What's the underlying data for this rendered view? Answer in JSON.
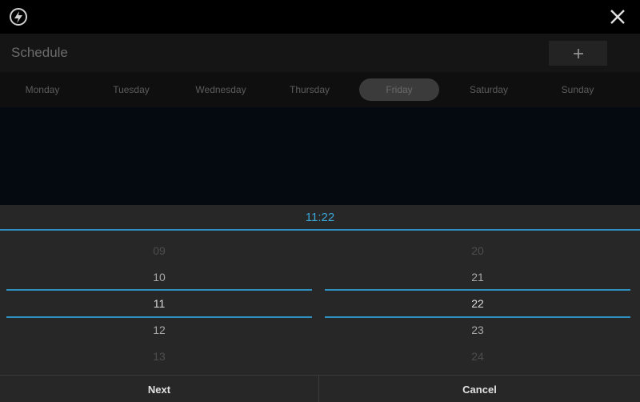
{
  "header": {
    "logo_icon": "bolt-circle-icon",
    "close_icon": "close-icon"
  },
  "schedule": {
    "title": "Schedule",
    "add_label": "+"
  },
  "days": [
    {
      "label": "Monday",
      "selected": false
    },
    {
      "label": "Tuesday",
      "selected": false
    },
    {
      "label": "Wednesday",
      "selected": false
    },
    {
      "label": "Thursday",
      "selected": false
    },
    {
      "label": "Friday",
      "selected": true
    },
    {
      "label": "Saturday",
      "selected": false
    },
    {
      "label": "Sunday",
      "selected": false
    }
  ],
  "picker": {
    "time": "11:22",
    "hours": [
      "09",
      "10",
      "11",
      "12",
      "13"
    ],
    "minutes": [
      "20",
      "21",
      "22",
      "23",
      "24"
    ],
    "selected_hour": "11",
    "selected_minute": "22"
  },
  "buttons": {
    "next": "Next",
    "cancel": "Cancel"
  },
  "colors": {
    "accent": "#2f8fc0",
    "accent_text": "#3aa6d8",
    "background": "#000000",
    "picker_bg": "#272727"
  }
}
